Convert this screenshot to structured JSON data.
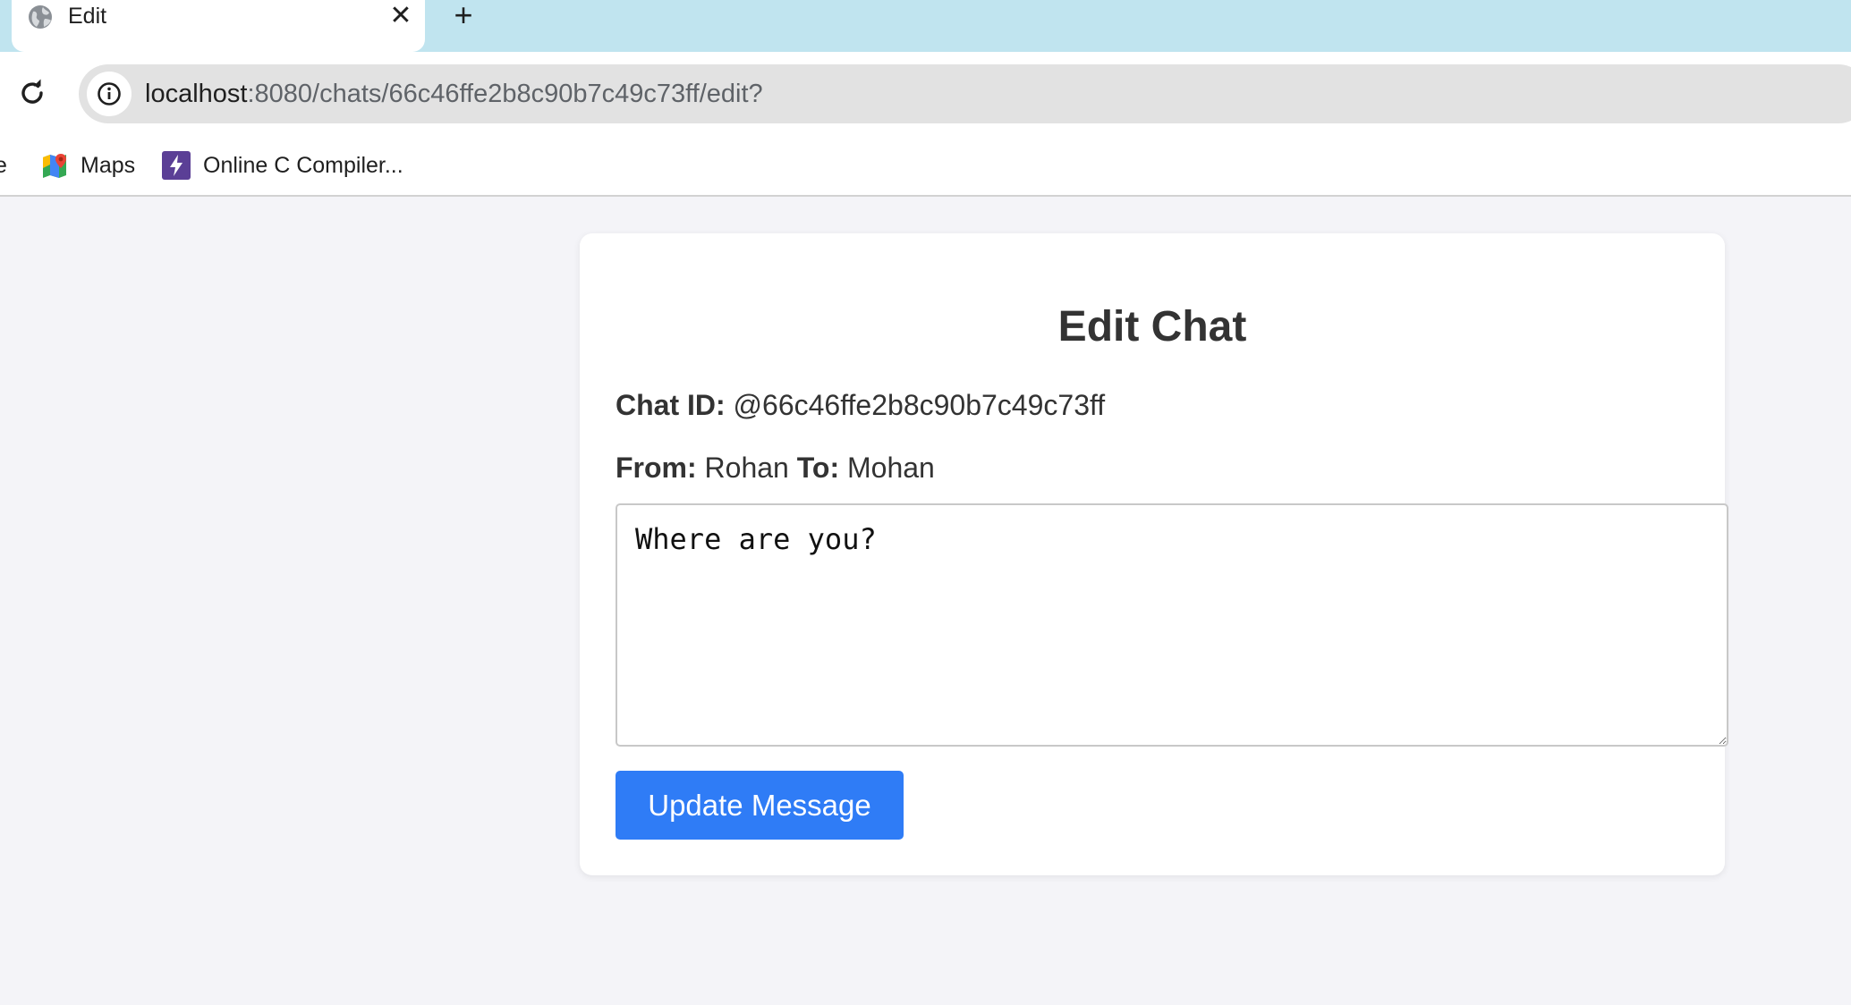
{
  "browser": {
    "tab": {
      "title": "Edit",
      "close_glyph": "✕",
      "favicon": "globe-icon"
    },
    "new_tab_glyph": "+",
    "address_bar": {
      "host": "localhost",
      "path": ":8080/chats/66c46ffe2b8c90b7c49c73ff/edit?"
    },
    "bookmarks": {
      "partial_label": "e",
      "items": [
        {
          "label": "Maps",
          "icon": "google-maps-icon"
        },
        {
          "label": "Online C Compiler...",
          "icon": "lightning-bolt-icon"
        }
      ]
    }
  },
  "page": {
    "title": "Edit Chat",
    "chat_id_label": "Chat ID:",
    "chat_id_value": " @66c46ffe2b8c90b7c49c73ff",
    "from_label": "From:",
    "from_value": " Rohan ",
    "to_label": "To:",
    "to_value": " Mohan",
    "message": "Where are you?",
    "submit_label": "Update Message"
  },
  "colors": {
    "tabstrip": "#c0e4ef",
    "page_background": "#f4f4f8",
    "button": "#2f7cf6"
  }
}
